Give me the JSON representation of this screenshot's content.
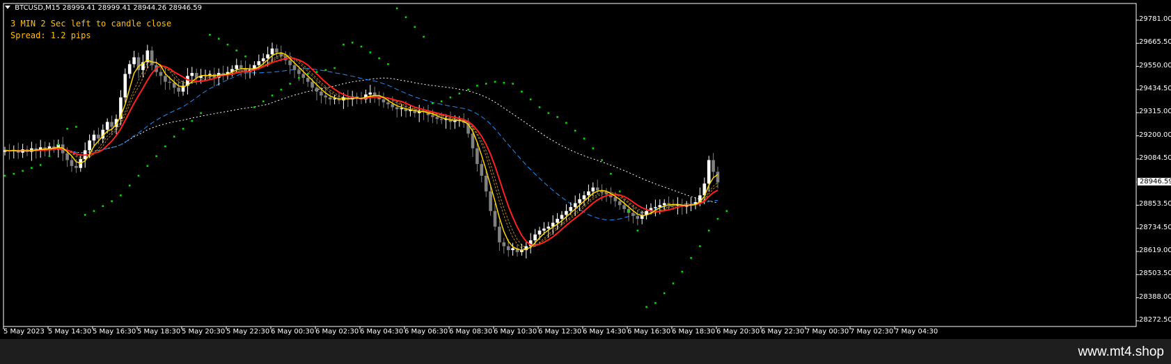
{
  "header": {
    "symbol": "BTCUSD,M15",
    "ohlc": "28999.41 28999.41 28944.26 28946.59"
  },
  "info": {
    "timer": "3 MIN 2 Sec left to candle close",
    "spread": "Spread: 1.2 pips"
  },
  "current_price": "28946.59",
  "watermark": "www.mt4.shop",
  "colors": {
    "background": "#000000",
    "bull_candle": "#ffffff",
    "bear_candle": "#808080",
    "ma_fast": "#ffd700",
    "ma_slow": "#ff2020",
    "ma_mid": "#b8860b",
    "ma_blue": "#1e90ff",
    "ma_long": "#ffffff",
    "sar": "#00e000",
    "info_text": "#ffc000"
  },
  "chart_data": {
    "type": "candlestick",
    "ylim": [
      28210,
      29860
    ],
    "y_ticks": [
      "29781.00",
      "29665.50",
      "29550.00",
      "29434.50",
      "29315.00",
      "29200.00",
      "29084.50",
      "28969.00",
      "28853.50",
      "28734.50",
      "28619.00",
      "28503.50",
      "28388.00",
      "28272.50"
    ],
    "x_ticks": [
      "5 May 2023",
      "5 May 14:30",
      "5 May 16:30",
      "5 May 18:30",
      "5 May 20:30",
      "5 May 22:30",
      "6 May 00:30",
      "6 May 02:30",
      "6 May 04:30",
      "6 May 06:30",
      "6 May 08:30",
      "6 May 10:30",
      "6 May 12:30",
      "6 May 14:30",
      "6 May 16:30",
      "6 May 18:30",
      "6 May 20:30",
      "6 May 22:30",
      "7 May 00:30",
      "7 May 02:30",
      "7 May 04:30"
    ],
    "x_tick_index": [
      0,
      8,
      16,
      24,
      32,
      40,
      48,
      56,
      64,
      72,
      80,
      88,
      96,
      104,
      112,
      120,
      128,
      136,
      144,
      152,
      160
    ],
    "close": [
      29110,
      29105,
      29112,
      29098,
      29115,
      29102,
      29120,
      29108,
      29125,
      29110,
      29130,
      29118,
      29140,
      29095,
      29060,
      29030,
      29020,
      29065,
      29110,
      29160,
      29190,
      29170,
      29215,
      29255,
      29230,
      29270,
      29380,
      29500,
      29550,
      29585,
      29520,
      29560,
      29620,
      29545,
      29510,
      29490,
      29460,
      29455,
      29430,
      29410,
      29440,
      29490,
      29505,
      29480,
      29490,
      29495,
      29500,
      29480,
      29505,
      29500,
      29510,
      29525,
      29545,
      29530,
      29510,
      29520,
      29545,
      29565,
      29580,
      29600,
      29630,
      29610,
      29590,
      29570,
      29545,
      29520,
      29500,
      29480,
      29460,
      29430,
      29410,
      29390,
      29380,
      29370,
      29375,
      29365,
      29380,
      29370,
      29385,
      29375,
      29370,
      29395,
      29405,
      29390,
      29370,
      29355,
      29345,
      29330,
      29320,
      29325,
      29310,
      29315,
      29300,
      29310,
      29305,
      29290,
      29280,
      29270,
      29265,
      29270,
      29255,
      29260,
      29265,
      29250,
      29195,
      29120,
      29040,
      28980,
      28900,
      28800,
      28720,
      28640,
      28620,
      28600,
      28610,
      28590,
      28600,
      28620,
      28650,
      28680,
      28700,
      28710,
      28720,
      28740,
      28760,
      28780,
      28800,
      28820,
      28840,
      28860,
      28880,
      28900,
      28920,
      28905,
      28895,
      28885,
      28870,
      28850,
      28830,
      28810,
      28790,
      28775,
      28760,
      28780,
      28800,
      28815,
      28820,
      28830,
      28840,
      28835,
      28828,
      28832,
      28822,
      28830,
      28835,
      28845,
      28880,
      28940,
      29060,
      29000,
      28946
    ],
    "sar_points": [
      [
        0,
        28980
      ],
      [
        2,
        28990
      ],
      [
        4,
        29005
      ],
      [
        6,
        29020
      ],
      [
        8,
        29035
      ],
      [
        10,
        29080
      ],
      [
        12,
        29140
      ],
      [
        14,
        29220
      ],
      [
        16,
        29230
      ],
      [
        18,
        28780
      ],
      [
        20,
        28800
      ],
      [
        22,
        28825
      ],
      [
        24,
        28850
      ],
      [
        26,
        28880
      ],
      [
        28,
        28930
      ],
      [
        30,
        28980
      ],
      [
        32,
        29030
      ],
      [
        34,
        29080
      ],
      [
        36,
        29130
      ],
      [
        38,
        29180
      ],
      [
        40,
        29220
      ],
      [
        42,
        29260
      ],
      [
        44,
        29300
      ],
      [
        46,
        29700
      ],
      [
        48,
        29680
      ],
      [
        50,
        29650
      ],
      [
        52,
        29620
      ],
      [
        54,
        29590
      ],
      [
        56,
        29330
      ],
      [
        58,
        29360
      ],
      [
        60,
        29390
      ],
      [
        62,
        29420
      ],
      [
        64,
        29450
      ],
      [
        66,
        29480
      ],
      [
        68,
        29500
      ],
      [
        70,
        29510
      ],
      [
        72,
        29520
      ],
      [
        74,
        29530
      ],
      [
        76,
        29650
      ],
      [
        78,
        29660
      ],
      [
        80,
        29640
      ],
      [
        82,
        29610
      ],
      [
        84,
        29580
      ],
      [
        86,
        29550
      ],
      [
        88,
        29835
      ],
      [
        90,
        29790
      ],
      [
        92,
        29740
      ],
      [
        94,
        29690
      ],
      [
        96,
        29350
      ],
      [
        98,
        29360
      ],
      [
        100,
        29380
      ],
      [
        102,
        29400
      ],
      [
        104,
        29420
      ],
      [
        106,
        29440
      ],
      [
        108,
        29450
      ],
      [
        110,
        29460
      ],
      [
        112,
        29455
      ],
      [
        114,
        29450
      ],
      [
        116,
        29410
      ],
      [
        118,
        29370
      ],
      [
        120,
        29330
      ],
      [
        122,
        29300
      ],
      [
        124,
        29280
      ],
      [
        126,
        29250
      ],
      [
        128,
        29210
      ],
      [
        130,
        29170
      ],
      [
        132,
        29120
      ],
      [
        134,
        29060
      ],
      [
        136,
        28990
      ],
      [
        138,
        28900
      ],
      [
        140,
        28800
      ],
      [
        142,
        28700
      ],
      [
        144,
        28310
      ],
      [
        146,
        28330
      ],
      [
        148,
        28380
      ],
      [
        150,
        28430
      ],
      [
        152,
        28490
      ],
      [
        154,
        28560
      ],
      [
        156,
        28620
      ],
      [
        158,
        28700
      ],
      [
        160,
        28760
      ],
      [
        162,
        28800
      ]
    ]
  }
}
